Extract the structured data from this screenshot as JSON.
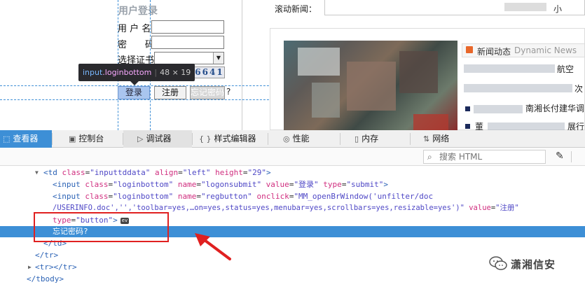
{
  "page": {
    "login": {
      "title": "用户登录",
      "username_label": "用 户 名",
      "password_label": "密　　码",
      "cert_label": "选择证书",
      "username_value": "",
      "password_value": "",
      "cert_value": "",
      "captcha_text": "6641",
      "login_button": "登录",
      "register_button": "注册",
      "forgot_button": "忘记密码",
      "forgot_suffix": "?"
    },
    "tooltip": {
      "tag": "input",
      "class": ".loginbottom",
      "dims": "48 × 19"
    },
    "news": {
      "label": "滚动新闻：",
      "tail_text": "小"
    },
    "dynamic": {
      "title": "新闻动态",
      "title_en": "Dynamic News",
      "items": [
        "航空",
        "次",
        "南湘长付建华调",
        "董",
        "展行"
      ]
    }
  },
  "devtools": {
    "tabs": [
      {
        "label": "查看器",
        "icon": "inspector-icon",
        "active": true
      },
      {
        "label": "控制台",
        "icon": "console-icon",
        "active": false
      },
      {
        "label": "调试器",
        "icon": "debugger-icon",
        "active": false
      },
      {
        "label": "样式编辑器",
        "icon": "style-editor-icon",
        "active": false
      },
      {
        "label": "性能",
        "icon": "performance-icon",
        "active": false
      },
      {
        "label": "内存",
        "icon": "memory-icon",
        "active": false
      },
      {
        "label": "网络",
        "icon": "network-icon",
        "active": false
      }
    ],
    "search_placeholder": "搜索 HTML",
    "markup": {
      "line1": {
        "open": "<td",
        "attr1": " class",
        "val1": "\"inputtddata\"",
        "attr2": " align",
        "val2": "\"left\"",
        "attr3": " height",
        "val3": "\"29\"",
        "close": ">"
      },
      "line2": {
        "open": "<input",
        "attr1": " class",
        "val1": "\"loginbottom\"",
        "attr2": " name",
        "val2": "\"logonsubmit\"",
        "attr3": " value",
        "val3": "\"登录\"",
        "attr4": " type",
        "val4": "\"submit\"",
        "close": ">"
      },
      "line3": {
        "open": "<input",
        "attr1": " class",
        "val1": "\"loginbottom\"",
        "attr2": " name",
        "val2": "\"regbutton\"",
        "attr3": " onclick",
        "val3": "\"MM_openBrWindow('unfilter/doc"
      },
      "line4": {
        "val": "/USERINFO.doc','','toolbar=yes,…on=yes,status=yes,menubar=yes,scrollbars=yes,resizable=yes')\"",
        "attr": " value",
        "val2": "\"注册\""
      },
      "line5": {
        "attr": "type",
        "val": "\"button\"",
        "close": ">",
        "badge": "ev"
      },
      "line6": {
        "text": "忘记密码?"
      },
      "line7": {
        "text": "</td>"
      },
      "line8": {
        "text": "</tr>"
      },
      "line9": {
        "text": "<tr></tr>"
      },
      "line10": {
        "text": "</tbody>"
      }
    }
  },
  "watermark": {
    "text": "潇湘信安"
  },
  "colors": {
    "accent": "#3d8fd6",
    "highlight_box": "#e02020"
  }
}
